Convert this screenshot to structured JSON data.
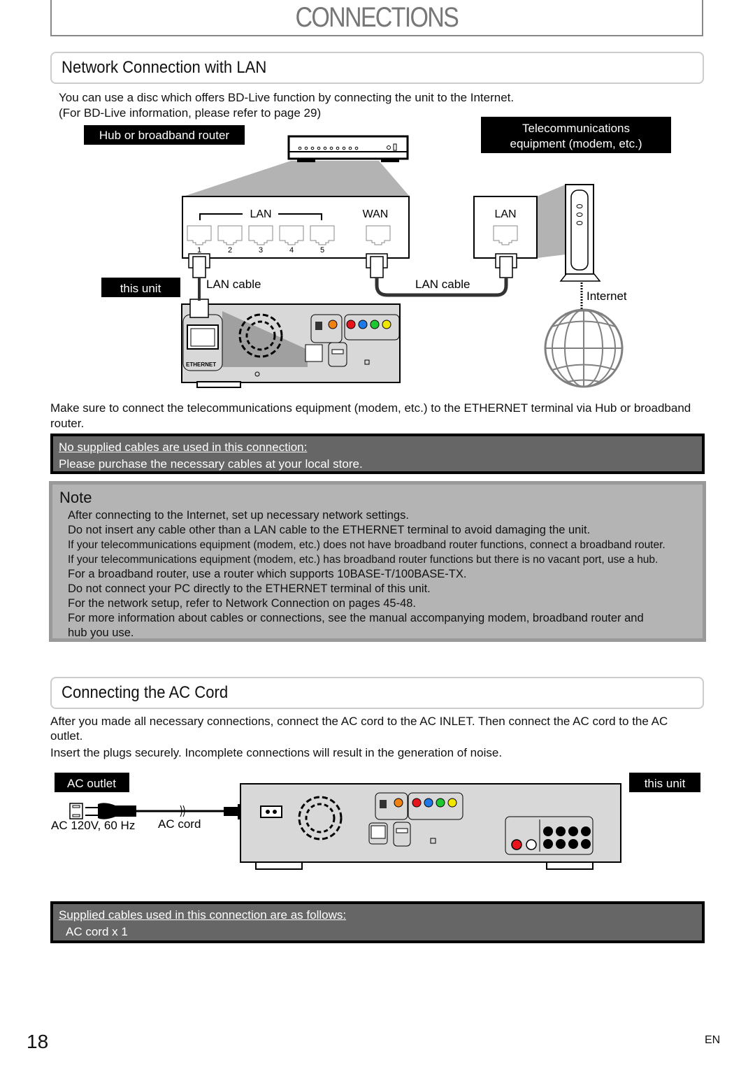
{
  "page": {
    "title": "CONNECTIONS",
    "page_number": "18",
    "language": "EN"
  },
  "lan_section": {
    "heading": "Network Connection with LAN",
    "intro_line1": "You can use a disc which offers BD-Live function by connecting the unit to the Internet.",
    "intro_line2": "(For BD-Live information, please refer to page 29)",
    "diagram": {
      "hub_label": "Hub or broadband router",
      "telecom_label_line1": "Telecommunications",
      "telecom_label_line2": "equipment (modem, etc.)",
      "router_lan_label": "LAN",
      "router_wan_label": "WAN",
      "router_port_numbers": [
        "1",
        "2",
        "3",
        "4",
        "5"
      ],
      "modem_lan_label": "LAN",
      "this_unit_label": "this unit",
      "lan_cable_label_1": "LAN cable",
      "lan_cable_label_2": "LAN cable",
      "internet_label": "Internet",
      "ethernet_label": "ETHERNET"
    },
    "body_text": "Make sure to connect the telecommunications equipment (modem, etc.) to the ETHERNET terminal via Hub or broadband router.",
    "cables_box": {
      "heading": "No supplied cables are used in this connection:",
      "text": "Please purchase the necessary cables at your local store."
    }
  },
  "note": {
    "heading": "Note",
    "items": [
      "After connecting to the Internet, set up necessary network settings.",
      "Do not insert any cable other than a LAN cable to the ETHERNET terminal to avoid damaging the unit.",
      "If your telecommunications equipment (modem, etc.) does not have broadband router functions, connect a broadband router.",
      "If your telecommunications equipment (modem, etc.) has broadband router functions but there is no vacant port, use a hub.",
      "For a broadband router, use a router which supports 10BASE-T/100BASE-TX.",
      "Do not connect your PC directly to the ETHERNET terminal of this unit.",
      "For the network setup, refer to  Network Connection  on pages 45-48.",
      "For more information about cables or connections, see the manual accompanying modem, broadband router and",
      "hub you use."
    ]
  },
  "ac_section": {
    "heading": "Connecting the AC Cord",
    "para1_line1": "After you made all necessary connections, connect the AC cord to the AC INLET. Then connect the AC cord to the AC",
    "para1_line2": "outlet.",
    "para2": "Insert the plugs securely. Incomplete connections will result in the generation of noise.",
    "diagram": {
      "ac_outlet_label": "AC outlet",
      "this_unit_label": "this unit",
      "voltage_label": "AC 120V, 60 Hz",
      "ac_cord_label": "AC cord"
    },
    "cables_box": {
      "heading": "Supplied cables used in this connection are as follows:",
      "text": "AC cord x 1"
    }
  },
  "colors": {
    "red_jack": "#e8141c",
    "blue_jack": "#1e78e6",
    "green_jack": "#1ec832",
    "yellow_jack": "#f0e600",
    "orange_jack": "#f08214",
    "panel_gray": "#d8d8d8",
    "callout_gray": "#b4b4b4"
  }
}
